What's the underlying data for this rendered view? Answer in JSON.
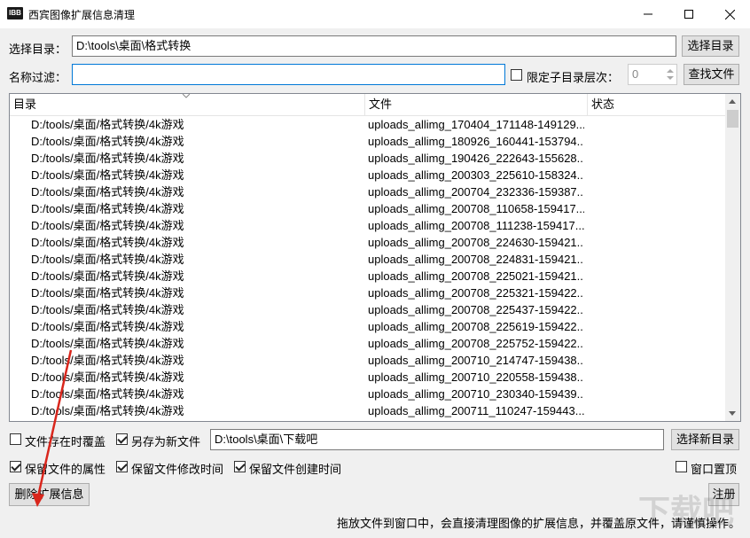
{
  "window": {
    "title": "西宾图像扩展信息清理",
    "icon_text": "IBB"
  },
  "dir_row": {
    "label": "选择目录：",
    "value": "D:\\tools\\桌面\\格式转换",
    "button": "选择目录"
  },
  "filter_row": {
    "label": "名称过滤：",
    "value": "",
    "limit_label": "限定子目录层次：",
    "depth_value": "0",
    "button": "查找文件"
  },
  "table": {
    "headers": [
      "目录",
      "文件",
      "状态"
    ],
    "rows": [
      {
        "dir": "D:/tools/桌面/格式转换/4k游戏",
        "file": "uploads_allimg_170404_171148-149129...",
        "status": ""
      },
      {
        "dir": "D:/tools/桌面/格式转换/4k游戏",
        "file": "uploads_allimg_180926_160441-153794...",
        "status": ""
      },
      {
        "dir": "D:/tools/桌面/格式转换/4k游戏",
        "file": "uploads_allimg_190426_222643-155628...",
        "status": ""
      },
      {
        "dir": "D:/tools/桌面/格式转换/4k游戏",
        "file": "uploads_allimg_200303_225610-158324...",
        "status": ""
      },
      {
        "dir": "D:/tools/桌面/格式转换/4k游戏",
        "file": "uploads_allimg_200704_232336-159387...",
        "status": ""
      },
      {
        "dir": "D:/tools/桌面/格式转换/4k游戏",
        "file": "uploads_allimg_200708_110658-159417...",
        "status": ""
      },
      {
        "dir": "D:/tools/桌面/格式转换/4k游戏",
        "file": "uploads_allimg_200708_111238-159417...",
        "status": ""
      },
      {
        "dir": "D:/tools/桌面/格式转换/4k游戏",
        "file": "uploads_allimg_200708_224630-159421...",
        "status": ""
      },
      {
        "dir": "D:/tools/桌面/格式转换/4k游戏",
        "file": "uploads_allimg_200708_224831-159421...",
        "status": ""
      },
      {
        "dir": "D:/tools/桌面/格式转换/4k游戏",
        "file": "uploads_allimg_200708_225021-159421...",
        "status": ""
      },
      {
        "dir": "D:/tools/桌面/格式转换/4k游戏",
        "file": "uploads_allimg_200708_225321-159422...",
        "status": ""
      },
      {
        "dir": "D:/tools/桌面/格式转换/4k游戏",
        "file": "uploads_allimg_200708_225437-159422...",
        "status": ""
      },
      {
        "dir": "D:/tools/桌面/格式转换/4k游戏",
        "file": "uploads_allimg_200708_225619-159422...",
        "status": ""
      },
      {
        "dir": "D:/tools/桌面/格式转换/4k游戏",
        "file": "uploads_allimg_200708_225752-159422...",
        "status": ""
      },
      {
        "dir": "D:/tools/桌面/格式转换/4k游戏",
        "file": "uploads_allimg_200710_214747-159438...",
        "status": ""
      },
      {
        "dir": "D:/tools/桌面/格式转换/4k游戏",
        "file": "uploads_allimg_200710_220558-159438...",
        "status": ""
      },
      {
        "dir": "D:/tools/桌面/格式转换/4k游戏",
        "file": "uploads_allimg_200710_230340-159439...",
        "status": ""
      },
      {
        "dir": "D:/tools/桌面/格式转换/4k游戏",
        "file": "uploads_allimg_200711_110247-159443...",
        "status": ""
      }
    ]
  },
  "options": {
    "overwrite_label": "文件存在时覆盖",
    "overwrite_checked": false,
    "save_as_label": "另存为新文件",
    "save_as_checked": true,
    "output_dir": "D:\\tools\\桌面\\下载吧",
    "output_button": "选择新目录",
    "keep_attr_label": "保留文件的属性",
    "keep_attr_checked": true,
    "keep_mtime_label": "保留文件修改时间",
    "keep_mtime_checked": true,
    "keep_ctime_label": "保留文件创建时间",
    "keep_ctime_checked": true,
    "topmost_label": "窗口置顶",
    "topmost_checked": false
  },
  "actions": {
    "delete_button": "删除扩展信息",
    "register_button": "注册"
  },
  "status_text": "拖放文件到窗口中，会直接清理图像的扩展信息，并覆盖原文件，请谨慎操作。",
  "watermark": "下载吧",
  "colors": {
    "accent": "#0078d7",
    "arrow": "#d9261c"
  }
}
